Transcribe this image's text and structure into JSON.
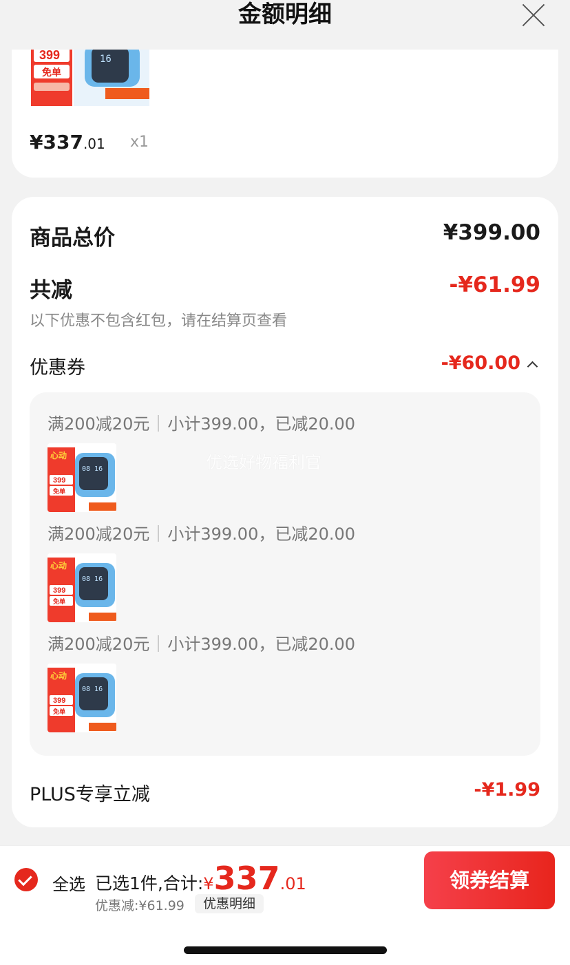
{
  "header": {
    "title": "金额明细"
  },
  "product": {
    "price_int": "¥337",
    "price_dec": ".01",
    "qty": "x1",
    "image": {
      "promo_price": "399",
      "promo_word": "免单",
      "screen_text": "16"
    }
  },
  "summary": {
    "total_label": "商品总价",
    "total_value": "¥399.00",
    "reduce_label": "共减",
    "reduce_value": "-¥61.99",
    "note": "以下优惠不包含红包，请在结算页查看",
    "coupon_label": "优惠券",
    "coupon_value": "-¥60.00",
    "plus_label": "PLUS专享立减",
    "plus_value": "-¥1.99"
  },
  "coupons": [
    {
      "rule": "满200减20元",
      "detail": "小计399.00，已减20.00"
    },
    {
      "rule": "满200减20元",
      "detail": "小计399.00，已减20.00"
    },
    {
      "rule": "满200减20元",
      "detail": "小计399.00，已减20.00"
    }
  ],
  "thumb": {
    "badge": "心动",
    "price": "399",
    "word": "免单",
    "screen": "08 16"
  },
  "watermark": "优选好物福利官",
  "bottom": {
    "select_all": "全选",
    "selected_prefix": "已选1件,合计:",
    "yen": "¥",
    "amount_int": "337",
    "amount_dec": ".01",
    "discount": "优惠减:¥61.99",
    "detail_button": "优惠明细",
    "pay_button": "领券结算"
  },
  "colors": {
    "accent": "#e5281d",
    "background": "#f2f2f2"
  }
}
